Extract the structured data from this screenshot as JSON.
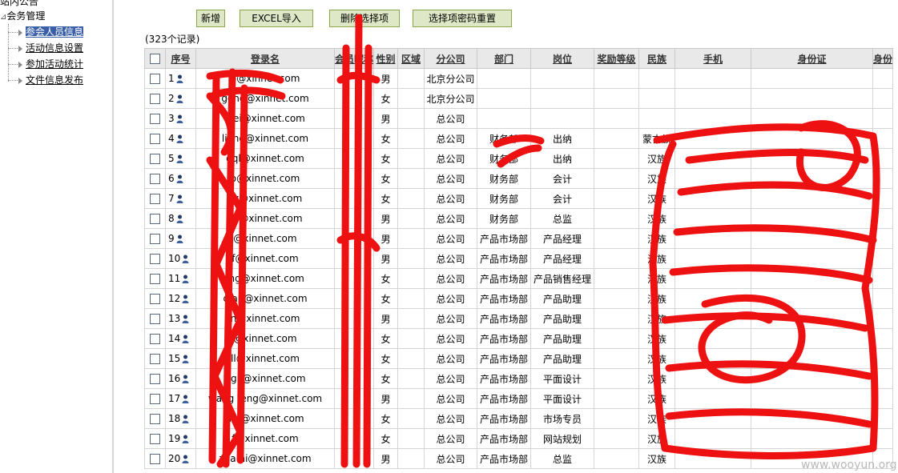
{
  "sidebar": {
    "top_item": "站内公告",
    "group_label": "会务管理",
    "items": [
      {
        "label": "参会人员信息",
        "active": true
      },
      {
        "label": "活动信息设置",
        "active": false
      },
      {
        "label": "参加活动统计",
        "active": false
      },
      {
        "label": "文件信息发布",
        "active": false
      }
    ]
  },
  "toolbar": {
    "add_label": "新增",
    "excel_label": "EXCEL导入",
    "delete_label": "删除选择项",
    "reset_label": "选择项密码重置"
  },
  "record_count": "(323个记录)",
  "table": {
    "headers": [
      "序号",
      "登录名",
      "会员昵称",
      "性别",
      "区域",
      "分公司",
      "部门",
      "岗位",
      "奖励等级",
      "民族",
      "手机",
      "身份证",
      "身份"
    ],
    "rows": [
      {
        "no": "1",
        "login": "p@xinnet.com",
        "gender": "男",
        "region": "",
        "branch": "北京分公司",
        "dept": "",
        "post": "",
        "ethnic": "",
        "mobile": "",
        "idcard": ""
      },
      {
        "no": "2",
        "login": "gong@xinnet.com",
        "gender": "女",
        "region": "",
        "branch": "北京分公司",
        "dept": "",
        "post": "",
        "ethnic": "",
        "mobile": "",
        "idcard": ""
      },
      {
        "no": "3",
        "login": "wei@xinnet.com",
        "gender": "男",
        "region": "",
        "branch": "总公司",
        "dept": "",
        "post": "",
        "ethnic": "",
        "mobile": "",
        "idcard": ""
      },
      {
        "no": "4",
        "login": "li ing@xinnet.com",
        "gender": "女",
        "region": "",
        "branch": "总公司",
        "dept": "财务部",
        "post": "出纳",
        "ethnic": "蒙古族",
        "mobile": "",
        "idcard": ""
      },
      {
        "no": "5",
        "login": "gql@xinnet.com",
        "gender": "女",
        "region": "",
        "branch": "总公司",
        "dept": "财务部",
        "post": "出纳",
        "ethnic": "汉族",
        "mobile": "",
        "idcard": ""
      },
      {
        "no": "6",
        "login": "o@xinnet.com",
        "gender": "女",
        "region": "",
        "branch": "总公司",
        "dept": "财务部",
        "post": "会计",
        "ethnic": "汉族",
        "mobile": "",
        "idcard": ""
      },
      {
        "no": "7",
        "login": "yz@xinnet.com",
        "gender": "女",
        "region": "",
        "branch": "总公司",
        "dept": "财务部",
        "post": "会计",
        "ethnic": "汉族",
        "mobile": "",
        "idcard": ""
      },
      {
        "no": "8",
        "login": "zh@xinnet.com",
        "gender": "男",
        "region": "",
        "branch": "总公司",
        "dept": "财务部",
        "post": "总监",
        "ethnic": "汉族",
        "mobile": "",
        "idcard": ""
      },
      {
        "no": "9",
        "login": "@xinnet.com",
        "gender": "男",
        "region": "",
        "branch": "总公司",
        "dept": "产品市场部",
        "post": "产品经理",
        "ethnic": "汉族",
        "mobile": "",
        "idcard": ""
      },
      {
        "no": "10",
        "login": "f@xinnet.com",
        "gender": "男",
        "region": "",
        "branch": "总公司",
        "dept": "产品市场部",
        "post": "产品经理",
        "ethnic": "汉族",
        "mobile": "",
        "idcard": ""
      },
      {
        "no": "11",
        "login": "ing@xinnet.com",
        "gender": "女",
        "region": "",
        "branch": "总公司",
        "dept": "产品市场部",
        "post": "产品销售经理",
        "ethnic": "汉族",
        "mobile": "",
        "idcard": ""
      },
      {
        "no": "12",
        "login": "qian@xinnet.com",
        "gender": "女",
        "region": "",
        "branch": "总公司",
        "dept": "产品市场部",
        "post": "产品助理",
        "ethnic": "汉族",
        "mobile": "",
        "idcard": ""
      },
      {
        "no": "13",
        "login": "n@xinnet.com",
        "gender": "男",
        "region": "",
        "branch": "总公司",
        "dept": "产品市场部",
        "post": "产品助理",
        "ethnic": "汉族",
        "mobile": "",
        "idcard": ""
      },
      {
        "no": "14",
        "login": "@xinnet.com",
        "gender": "女",
        "region": "",
        "branch": "总公司",
        "dept": "产品市场部",
        "post": "产品助理",
        "ethnic": "汉族",
        "mobile": "",
        "idcard": ""
      },
      {
        "no": "15",
        "login": "ll@xinnet.com",
        "gender": "女",
        "region": "",
        "branch": "总公司",
        "dept": "产品市场部",
        "post": "产品助理",
        "ethnic": "汉族",
        "mobile": "",
        "idcard": ""
      },
      {
        "no": "16",
        "login": "ngli@xinnet.com",
        "gender": "女",
        "region": "",
        "branch": "总公司",
        "dept": "产品市场部",
        "post": "平面设计",
        "ethnic": "汉族",
        "mobile": "",
        "idcard": ""
      },
      {
        "no": "17",
        "login": "wang feng@xinnet.com",
        "gender": "男",
        "region": "",
        "branch": "总公司",
        "dept": "产品市场部",
        "post": "平面设计",
        "ethnic": "汉族",
        "mobile": "",
        "idcard": ""
      },
      {
        "no": "18",
        "login": "li n@xinnet.com",
        "gender": "女",
        "region": "",
        "branch": "总公司",
        "dept": "产品市场部",
        "post": "市场专员",
        "ethnic": "汉族",
        "mobile": "",
        "idcard": ""
      },
      {
        "no": "19",
        "login": "f@xinnet.com",
        "gender": "女",
        "region": "",
        "branch": "总公司",
        "dept": "产品市场部",
        "post": "网站规划",
        "ethnic": "汉族",
        "mobile": "",
        "idcard": ""
      },
      {
        "no": "20",
        "login": "zha hi@xinnet.com",
        "gender": "男",
        "region": "",
        "branch": "总公司",
        "dept": "产品市场部",
        "post": "总监",
        "ethnic": "汉族",
        "mobile": "",
        "idcard": ""
      }
    ]
  },
  "watermark": "www.wooyun.org",
  "colors": {
    "redaction": "#ee1111",
    "active_nav": "#3a5fa8",
    "button_bg": "#dfe8c6"
  }
}
